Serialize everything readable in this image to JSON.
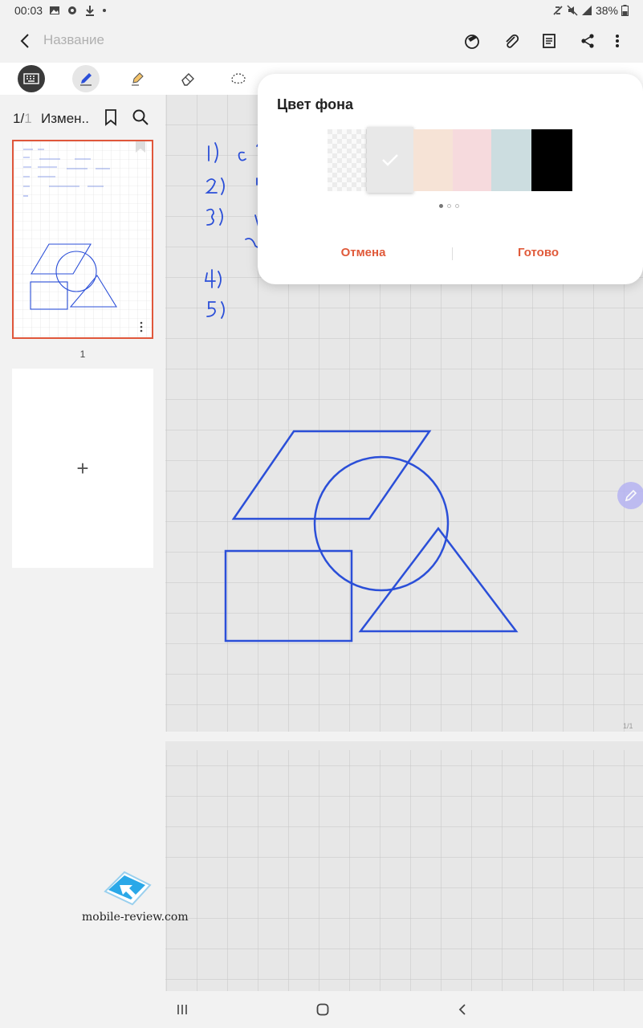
{
  "status_bar": {
    "time": "00:03",
    "left_icons": [
      "image-icon",
      "gear-icon",
      "download-icon",
      "dot-icon"
    ],
    "right_icons": [
      "sync-icon",
      "mute-icon",
      "signal-icon"
    ],
    "battery": "38%"
  },
  "app_bar": {
    "title_placeholder": "Название",
    "icons": [
      "back-icon",
      "handwriting-icon",
      "attach-icon",
      "page-template-icon",
      "share-icon",
      "more-icon"
    ]
  },
  "toolbar": {
    "tools": [
      "keyboard-icon",
      "pen-icon",
      "highlighter-icon",
      "eraser-icon",
      "lasso-icon"
    ],
    "selected_tool": "pen-icon",
    "accent_color": "#2b4fd8"
  },
  "sidebar": {
    "page_current": "1/",
    "page_total": "1",
    "doc_name": "Измен..",
    "thumbnails": [
      {
        "number": "1",
        "selected": true
      }
    ],
    "add_page_label": "+"
  },
  "canvas": {
    "stroke_color": "#2b4fd8",
    "page_indicator": "1/1",
    "list_items": [
      "1)",
      "2)",
      "3)",
      "4)",
      "5)"
    ]
  },
  "popup": {
    "title": "Цвет фона",
    "swatches": [
      {
        "name": "transparent",
        "color": "transparent",
        "selected": false
      },
      {
        "name": "gray",
        "color": "#e8e8e8",
        "selected": true
      },
      {
        "name": "peach",
        "color": "#f6e3d6",
        "selected": false
      },
      {
        "name": "pink",
        "color": "#f6dadd",
        "selected": false
      },
      {
        "name": "blue-gray",
        "color": "#ccdde0",
        "selected": false
      },
      {
        "name": "black",
        "color": "#000000",
        "selected": false
      }
    ],
    "pager": {
      "count": 3,
      "active": 1
    },
    "cancel_label": "Отмена",
    "done_label": "Готово",
    "accent_color": "#e05a3a"
  },
  "watermark": {
    "text": "mobile-review.com"
  },
  "nav_bar": {
    "icons": [
      "recents-icon",
      "home-icon",
      "back-nav-icon"
    ]
  }
}
